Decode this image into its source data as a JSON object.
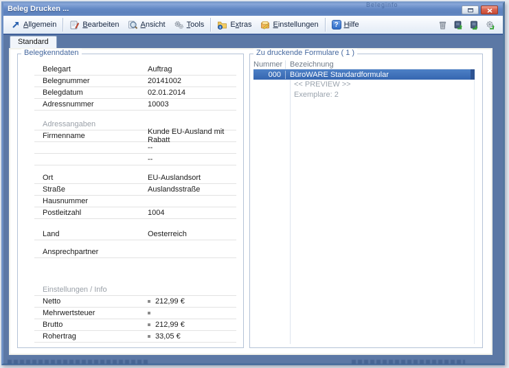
{
  "window": {
    "title": "Beleg Drucken ...",
    "watermark": "Beleginfo"
  },
  "toolbar": {
    "menu": [
      {
        "pre": "",
        "key": "A",
        "post": "llgemein"
      },
      {
        "pre": "",
        "key": "B",
        "post": "earbeiten"
      },
      {
        "pre": "",
        "key": "A",
        "post": "nsicht"
      },
      {
        "pre": "",
        "key": "T",
        "post": "ools"
      },
      {
        "pre": "E",
        "key": "x",
        "post": "tras"
      },
      {
        "pre": "",
        "key": "E",
        "post": "instellungen"
      },
      {
        "pre": "",
        "key": "H",
        "post": "ilfe"
      }
    ],
    "help_glyph": "?"
  },
  "tab": {
    "label": "Standard"
  },
  "belegkenndaten": {
    "title": "Belegkenndaten",
    "fields": [
      {
        "label": "Belegart",
        "value": "Auftrag"
      },
      {
        "label": "Belegnummer",
        "value": "20141002"
      },
      {
        "label": "Belegdatum",
        "value": "02.01.2014"
      },
      {
        "label": "Adressnummer",
        "value": "10003"
      },
      {
        "label": "Adressangaben",
        "value": ""
      },
      {
        "label": "Firmenname",
        "value": "Kunde EU-Ausland mit Rabatt"
      },
      {
        "label": "",
        "value": "--"
      },
      {
        "label": "",
        "value": "--"
      },
      {
        "label": "Ort",
        "value": "EU-Auslandsort"
      },
      {
        "label": "Straße",
        "value": "Auslandsstraße"
      },
      {
        "label": "Hausnummer",
        "value": ""
      },
      {
        "label": "Postleitzahl",
        "value": "1004"
      },
      {
        "label": "Land",
        "value": "Oesterreich"
      },
      {
        "label": "Ansprechpartner",
        "value": ""
      },
      {
        "label": "Einstellungen / Info",
        "value": ""
      },
      {
        "label": "Netto",
        "value": "212,99 €"
      },
      {
        "label": "Mehrwertsteuer",
        "value": ""
      },
      {
        "label": "Brutto",
        "value": "212,99 €"
      },
      {
        "label": "Rohertrag",
        "value": "33,05 €"
      }
    ]
  },
  "formulare": {
    "title": "Zu druckende Formulare ( 1 )",
    "col_nummer": "Nummer",
    "col_bezeichnung": "Bezeichnung",
    "row": {
      "nummer": "000",
      "bezeichnung": "BüroWARE Standardformular"
    },
    "preview": "<< PREVIEW >>",
    "exemplare": "Exemplare: 2"
  }
}
